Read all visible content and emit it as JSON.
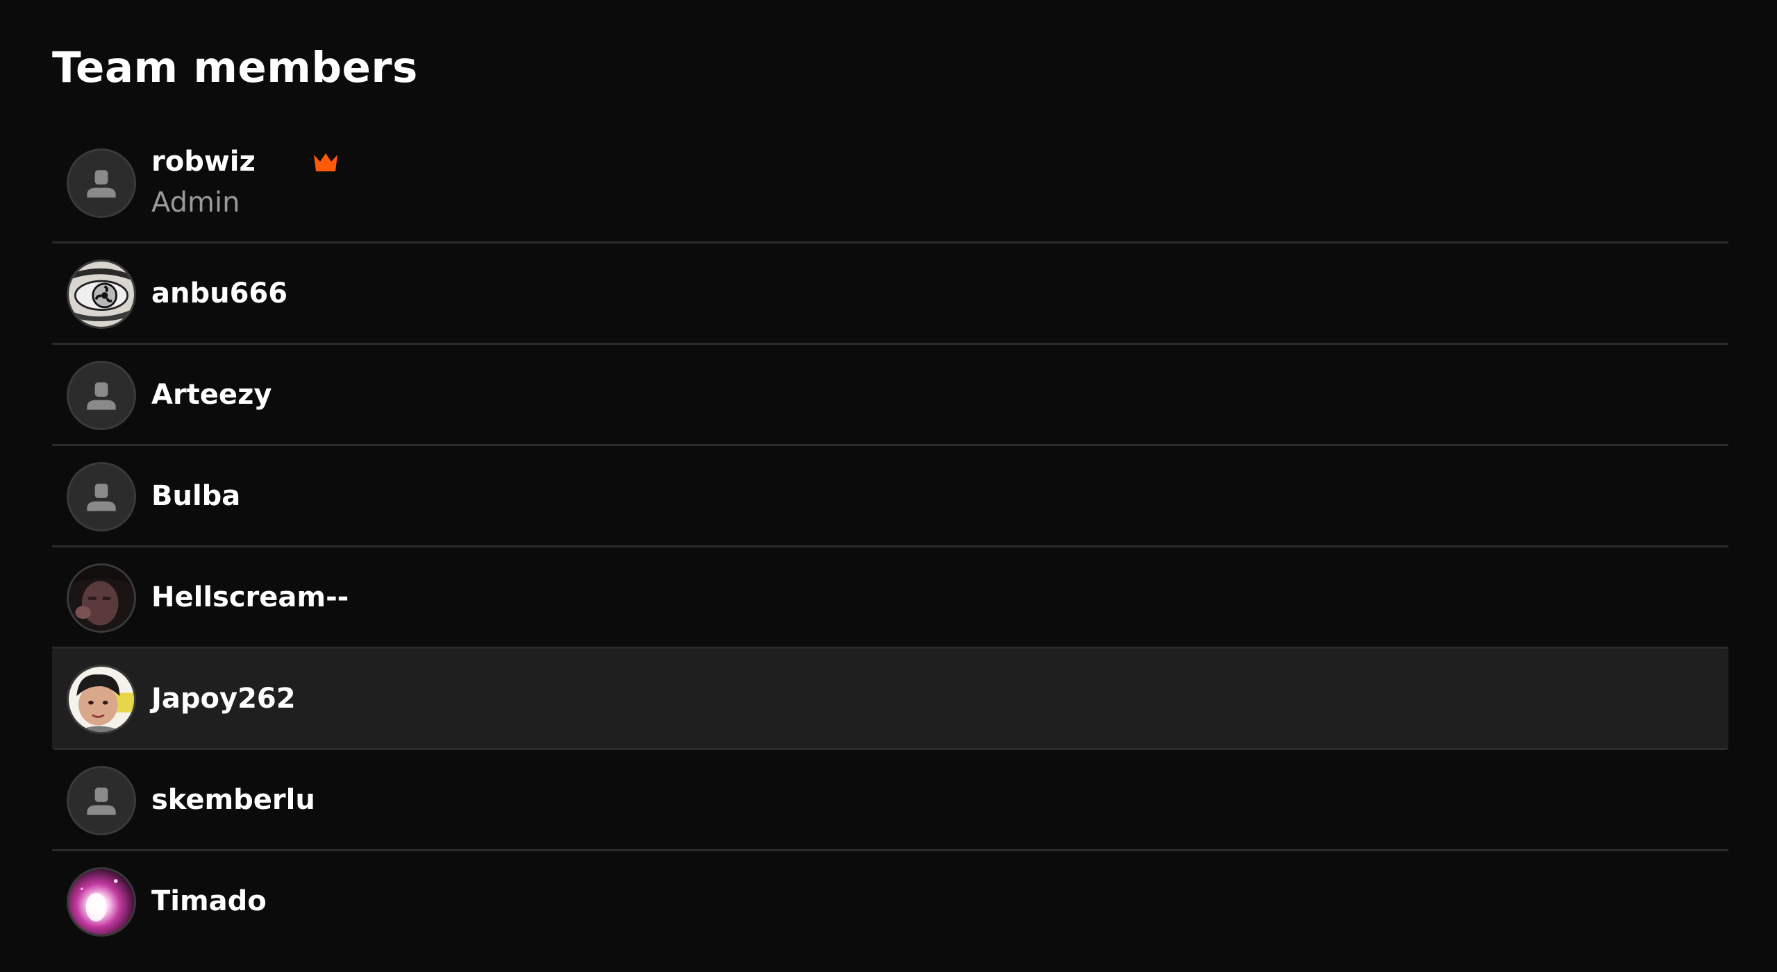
{
  "page": {
    "title": "Team members"
  },
  "colors": {
    "background": "#0b0b0b",
    "divider": "#2b2b2b",
    "highlight_row": "#1f1f1f",
    "crown": "#ff5a0a",
    "role_text": "#9a9a9a"
  },
  "members": [
    {
      "name": "robwiz",
      "role": "Admin",
      "avatar": "default-avatar-icon",
      "badge": "crown-icon"
    },
    {
      "name": "anbu666",
      "avatar": "sharingan-eye-avatar"
    },
    {
      "name": "Arteezy",
      "avatar": "default-avatar-icon"
    },
    {
      "name": "Bulba",
      "avatar": "default-avatar-icon"
    },
    {
      "name": "Hellscream--",
      "avatar": "face-photo-avatar"
    },
    {
      "name": "Japoy262",
      "avatar": "boy-photo-avatar",
      "highlighted": true
    },
    {
      "name": "skemberlu",
      "avatar": "default-avatar-icon"
    },
    {
      "name": "Timado",
      "avatar": "pink-glow-avatar"
    }
  ]
}
